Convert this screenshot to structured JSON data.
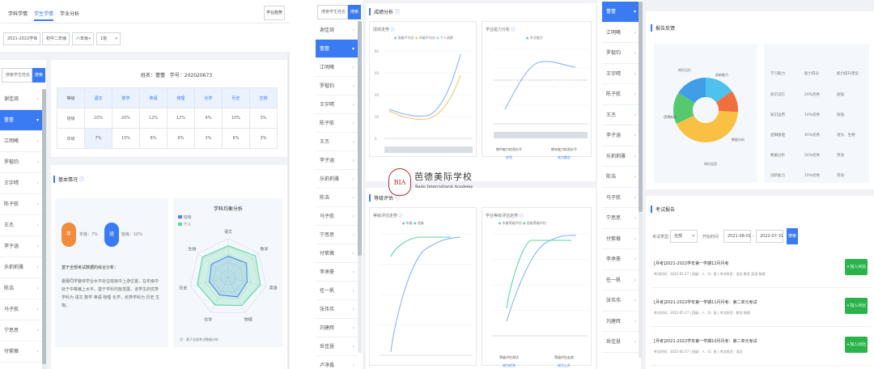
{
  "panel1": {
    "tabs": [
      "学科学情",
      "学生学情",
      "学业分析"
    ],
    "top_right_button": "学业趋势",
    "filters": [
      "2021-2022学年",
      "初中二年级",
      "八年级",
      "1班"
    ],
    "search_placeholder": "搜索学生姓名",
    "search_button": "搜索",
    "students": [
      "谢佳琦",
      "蕾蕾",
      "江明曦",
      "罗楷钧",
      "王宇晴",
      "陈子航",
      "王杰",
      "李子涵",
      "乐莉莉雅",
      "陈浩",
      "马子航",
      "宁思思",
      "付紫薇"
    ],
    "active_index": 1,
    "info": {
      "name_label": "姓名：",
      "name": "蕾蕾",
      "id_label": "学号：",
      "id": "202020673"
    },
    "table": {
      "headers": [
        "等级",
        "语文",
        "数学",
        "英语",
        "物理",
        "化学",
        "历史",
        "生物"
      ],
      "rows": [
        [
          "班级",
          "10%",
          "20%",
          "12%",
          "12%",
          "4%",
          "10%",
          "3%"
        ],
        [
          "年级",
          "7%",
          "15%",
          "8%",
          "8%",
          "3%",
          "8%",
          "3%"
        ]
      ]
    },
    "basic_title": "基本情况",
    "rank": {
      "year_char": "年",
      "year_text": "年级：7%",
      "class_char": "班",
      "class_text": "班级：10%"
    },
    "analysis_title": "基于全部考试数据的综合分析：",
    "analysis_text": "蕾蕾同学整体学业水平处在班级中上游位置，在年级中处于中等偏上水平。基于学科均衡发展，该学生的优势学科为 语文 数学 英语 物理 化学，劣势学科为 历史 生物。",
    "radar": {
      "title": "学科均衡分析",
      "legend": [
        "班级",
        "个人"
      ],
      "axes": [
        "语文",
        "数学",
        "英语",
        "物理",
        "化学",
        "历史",
        "生物"
      ],
      "note": "注：基于全部考试数据分析"
    }
  },
  "panel2": {
    "search_placeholder": "搜索学生姓名",
    "search_button": "搜索",
    "students": [
      "谢佳琦",
      "蕾蕾",
      "江明曦",
      "罗楷钧",
      "王宇晴",
      "陈子航",
      "王杰",
      "李子涵",
      "乐莉莉雅",
      "陈浩",
      "马子航",
      "宁思思",
      "付紫薇",
      "李承豪",
      "任一帆",
      "张伟伟",
      "刘建辉",
      "岳佳慧",
      "卢淳鑫"
    ],
    "active_index": 1,
    "trend_title": "成绩分析",
    "chart_a_title": "成绩走势",
    "chart_a_legend": [
      "班级平均分",
      "年级平均分",
      "个人成绩"
    ],
    "chart_b_title": "学业能力分析",
    "chart_b_legend": [
      "学业能力"
    ],
    "chart_b_labels": [
      {
        "name": "期中能力检测水平",
        "value": "优秀"
      },
      {
        "name": "期末能力检测水平",
        "value": "较为稳定"
      }
    ],
    "ability_title": "等级评估",
    "chart_c_title": "等级评估走势",
    "chart_c_legend": [
      "年级",
      "班级"
    ],
    "chart_d_title": "学业等级评估走势",
    "chart_d_legend": [
      "年级等级评估",
      "班级等级评估"
    ],
    "chart_d_labels": [
      {
        "name": "等级评估测试",
        "value": "较为优秀"
      },
      {
        "name": "等级评估走势",
        "value": "较为上升"
      }
    ]
  },
  "watermark": {
    "cn": "芭德美际学校",
    "en": "Bade Intercultural Academy",
    "logo": "BIA"
  },
  "panel3": {
    "students": [
      "蕾蕾",
      "江明曦",
      "罗楷钧",
      "王宇晴",
      "陈子航",
      "王杰",
      "李子涵",
      "乐莉莉雅",
      "陈浩",
      "马子航",
      "宁思思",
      "付紫薇",
      "李承豪",
      "任一帆",
      "张伟伟",
      "刘建辉",
      "岳佳慧"
    ],
    "active_index": 0,
    "section_title": "报告反馈",
    "donut_labels": [
      "知识记忆",
      "数据分析",
      "知识运用",
      "逻辑推理",
      "创新能力"
    ],
    "ability_table": {
      "headers": [
        "学习能力",
        "能力得分",
        "能力提升建议"
      ],
      "rows": [
        [
          "知识记忆",
          "20%优秀",
          "加强"
        ],
        [
          "知识运用",
          "10%优秀",
          "加强"
        ],
        [
          "逻辑推理",
          "40%优秀",
          "语文、生物"
        ],
        [
          "数据分析",
          "20%优秀",
          "英语"
        ],
        [
          "创新能力",
          "10%优秀",
          "英语"
        ]
      ]
    },
    "exam_title": "考试报告",
    "filter_label": "考试类型：",
    "filter_value": "全部",
    "date_label": "开始时间",
    "date_start": "2021-08-01",
    "date_end": "2022-07-31",
    "search_button": "搜索",
    "exams": [
      {
        "title": "[月考]2021-2022学年第一学期12月月考",
        "meta": "考试时间：2022-05-27 | 班级：八（1）班 | 考试科目：语文 数学 英语 物理",
        "button": "+加入对比"
      },
      {
        "title": "[月考]2021-2022学年第一学期11月月考：第二单元考试",
        "meta": "考试时间：2022-05-27 | 班级：八（1）班 | 考试科目：数学 物理",
        "button": "+加入对比"
      },
      {
        "title": "[月考]2021-2022学年第一学期10月月考：第二单元考试",
        "meta": "考试时间：2022-05-27 | 班级：八（1）班 | 考试科目：语文",
        "button": "+加入对比"
      }
    ]
  }
}
